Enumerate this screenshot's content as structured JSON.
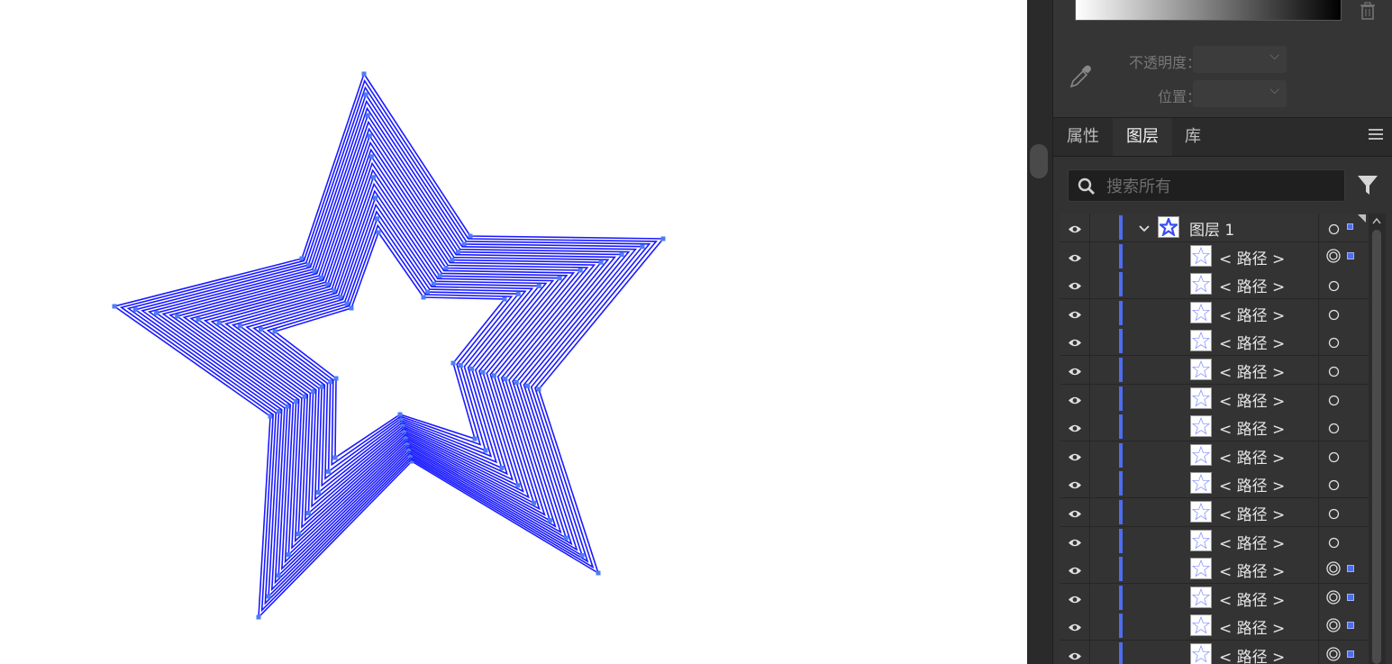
{
  "gradient": {
    "opacity_label": "不透明度：",
    "position_label": "位置："
  },
  "tabs": [
    {
      "label": "属性",
      "active": false
    },
    {
      "label": "图层",
      "active": true
    },
    {
      "label": "库",
      "active": false
    }
  ],
  "search": {
    "placeholder": "搜索所有"
  },
  "layers": {
    "top_layer": {
      "name": "图层 1",
      "expanded": true,
      "selected": true
    },
    "items": [
      {
        "name": "< 路径 >",
        "targeted": true,
        "selected": true
      },
      {
        "name": "< 路径 >",
        "targeted": false,
        "selected": false
      },
      {
        "name": "< 路径 >",
        "targeted": false,
        "selected": false
      },
      {
        "name": "< 路径 >",
        "targeted": false,
        "selected": false
      },
      {
        "name": "< 路径 >",
        "targeted": false,
        "selected": false
      },
      {
        "name": "< 路径 >",
        "targeted": false,
        "selected": false
      },
      {
        "name": "< 路径 >",
        "targeted": false,
        "selected": false
      },
      {
        "name": "< 路径 >",
        "targeted": false,
        "selected": false
      },
      {
        "name": "< 路径 >",
        "targeted": false,
        "selected": false
      },
      {
        "name": "< 路径 >",
        "targeted": false,
        "selected": false
      },
      {
        "name": "< 路径 >",
        "targeted": false,
        "selected": false
      },
      {
        "name": "< 路径 >",
        "targeted": true,
        "selected": true
      },
      {
        "name": "< 路径 >",
        "targeted": true,
        "selected": true
      },
      {
        "name": "< 路径 >",
        "targeted": true,
        "selected": true
      },
      {
        "name": "< 路径 >",
        "targeted": true,
        "selected": true
      }
    ]
  },
  "colors": {
    "selection_blue": "#1a1aff",
    "anchor_blue": "#4d7cf5",
    "layer_color": "#4d6cf0",
    "panel_bg": "#323232"
  },
  "icons": {
    "visibility": "eye-icon",
    "search": "search-icon",
    "filter": "filter-icon",
    "eyedropper": "eyedropper-icon",
    "trash": "trash-icon",
    "panel_menu": "hamburger-menu-icon"
  }
}
